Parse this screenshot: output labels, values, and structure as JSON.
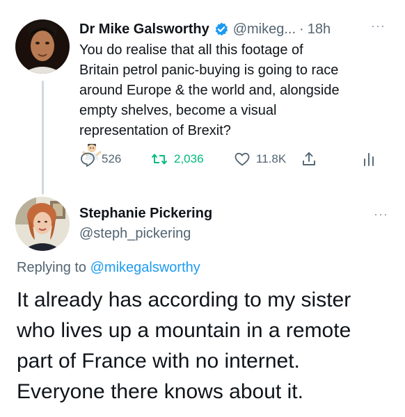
{
  "tweet": {
    "display_name": "Dr Mike Galsworthy",
    "handle": "@mikeg...",
    "separator": "·",
    "time": "18h",
    "more": "···",
    "text_lines": [
      "You do realise that all this footage of",
      "Britain petrol panic-buying is going to race",
      "around Europe & the world and, alongside",
      "empty shelves, become a visual",
      "representation of Brexit?"
    ],
    "emoji": "person-shrugging-emoji",
    "reply_count": "526",
    "retweet_count": "2,036",
    "like_count": "11.8K",
    "verified_color": "#1d9bf0",
    "retweet_color": "#00ba7c"
  },
  "reply": {
    "display_name": "Stephanie Pickering",
    "handle": "@steph_pickering",
    "more": "···",
    "replying_prefix": "Replying to",
    "replying_to": "@mikegalsworthy",
    "text_lines": [
      "It already has according to my sister",
      "who lives up a mountain in a remote",
      "part of France with no internet.",
      "Everyone there knows about it."
    ],
    "mention_color": "#1d9bf0"
  }
}
